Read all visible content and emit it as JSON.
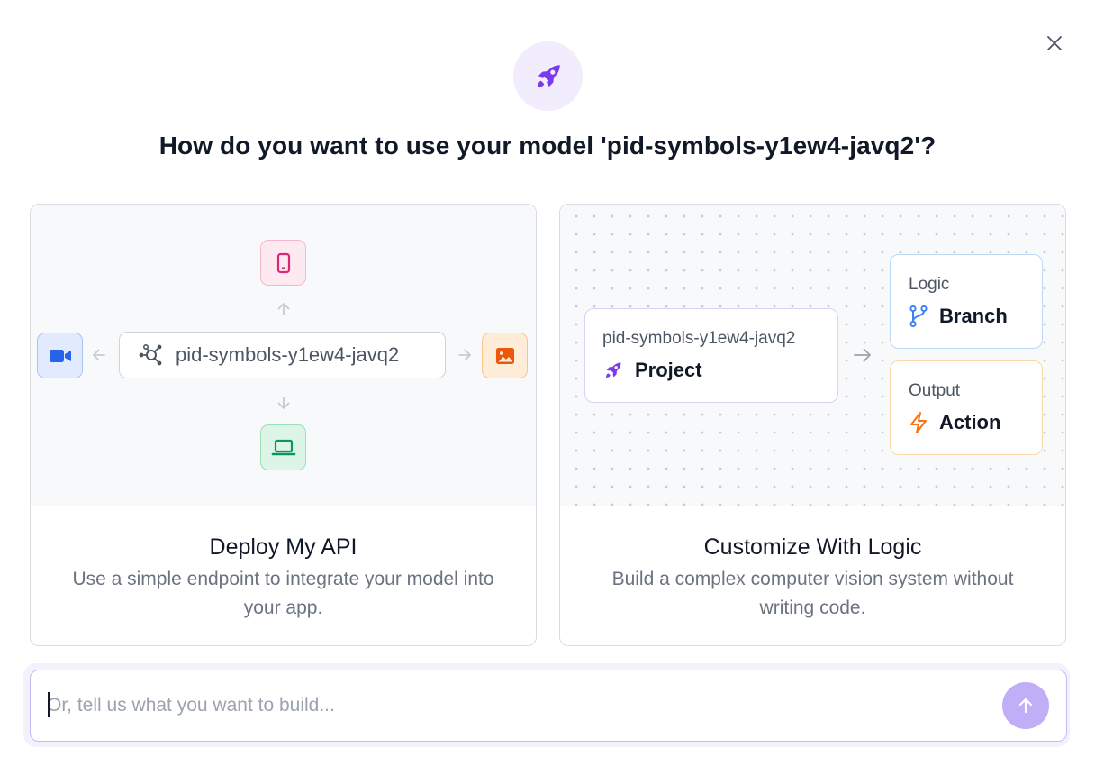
{
  "dialog": {
    "title": "How do you want to use your model 'pid-symbols-y1ew4-javq2'?",
    "close_icon": "close-icon",
    "hero_icon": "rocket-icon"
  },
  "cards": [
    {
      "id": "deploy",
      "title": "Deploy My API",
      "description": "Use a simple endpoint to integrate your model into your app.",
      "illustration": {
        "model_name": "pid-symbols-y1ew4-javq2",
        "center_icon": "network-icon",
        "targets": [
          "phone-icon",
          "video-icon",
          "image-icon",
          "laptop-icon"
        ]
      }
    },
    {
      "id": "logic",
      "title": "Customize With Logic",
      "description": "Build a complex computer vision system without writing code.",
      "illustration": {
        "project": {
          "subtitle": "pid-symbols-y1ew4-javq2",
          "label": "Project",
          "icon": "rocket-icon"
        },
        "logic": {
          "subtitle": "Logic",
          "label": "Branch",
          "icon": "branch-icon"
        },
        "output": {
          "subtitle": "Output",
          "label": "Action",
          "icon": "lightning-icon"
        }
      }
    }
  ],
  "prompt": {
    "placeholder": "Or, tell us what you want to build...",
    "value": "",
    "send_icon": "arrow-up-icon"
  },
  "colors": {
    "accent": "#7c3aed",
    "hero_bg": "#f1edfc",
    "send_button": "#c0aef7",
    "phone": "#db2777",
    "video": "#2563eb",
    "image": "#ea580c",
    "laptop": "#059669",
    "branch": "#3b82f6",
    "action": "#f97316"
  }
}
